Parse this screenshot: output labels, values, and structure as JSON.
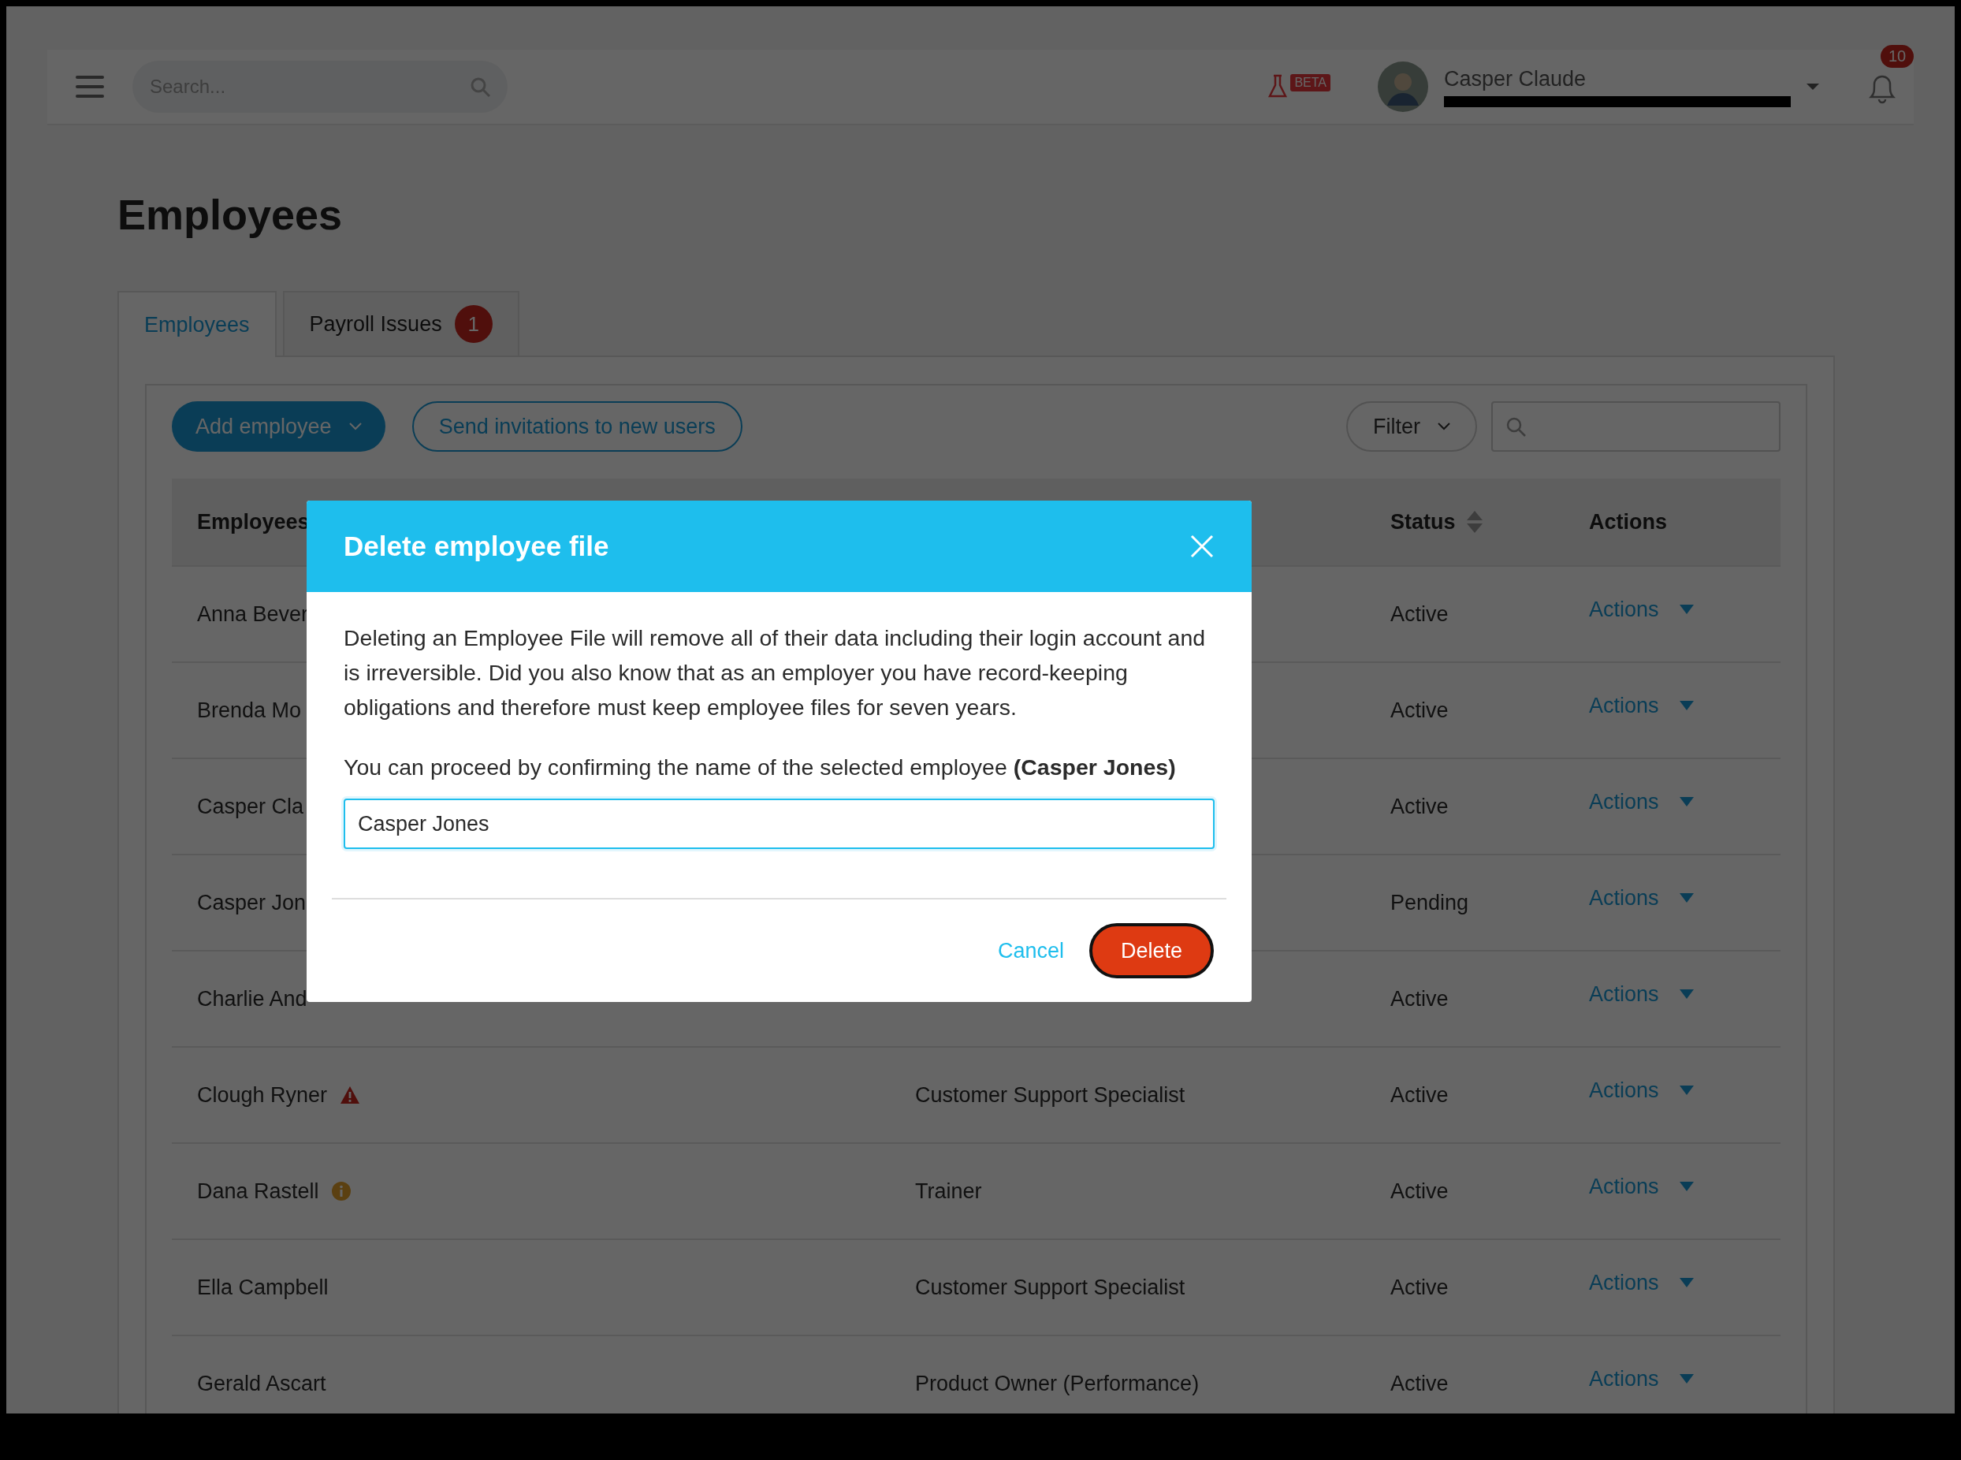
{
  "topbar": {
    "search": {
      "placeholder": "Search..."
    },
    "beta_badge": "BETA",
    "user": {
      "name": "Casper Claude"
    },
    "notifications": {
      "count": "10"
    }
  },
  "page_title": "Employees",
  "tabs": [
    {
      "label": "Employees",
      "selected": true
    },
    {
      "label": "Payroll Issues",
      "selected": false,
      "badge": "1"
    }
  ],
  "toolbar": {
    "add_button": "Add employee",
    "invite_button": "Send invitations to new users",
    "filter_button": "Filter"
  },
  "table": {
    "columns": [
      {
        "label": "Employees",
        "sortable": false
      },
      {
        "label": "Status",
        "sortable": true
      },
      {
        "label": "Actions",
        "sortable": false
      }
    ],
    "rows": [
      {
        "kind": "plain",
        "name": "Anna Bever",
        "status": "Active",
        "action": "Actions"
      },
      {
        "kind": "plain",
        "name": "Brenda Mo",
        "status": "Active",
        "action": "Actions"
      },
      {
        "kind": "plain",
        "name": "Casper Cla",
        "status": "Active",
        "action": "Actions"
      },
      {
        "kind": "plain",
        "name": "Casper Jon",
        "status": "Pending",
        "action": "Actions"
      },
      {
        "kind": "plain",
        "name": "Charlie And",
        "status": "Active",
        "action": "Actions"
      },
      {
        "kind": "warning",
        "name": "Clough Ryner",
        "title": "Customer Support Specialist",
        "status": "Active",
        "action": "Actions"
      },
      {
        "kind": "info",
        "name": "Dana Rastell",
        "title": "Trainer",
        "status": "Active",
        "action": "Actions"
      },
      {
        "kind": "plain",
        "name": "Ella Campbell",
        "title": "Customer Support Specialist",
        "status": "Active",
        "action": "Actions"
      },
      {
        "kind": "plain",
        "name": "Gerald Ascart",
        "title": "Product Owner (Performance)",
        "status": "Active",
        "action": "Actions"
      }
    ]
  },
  "dialog": {
    "title": "Delete employee file",
    "message": "Deleting an Employee File will remove all of their data including their login account and is irreversible. Did you also know that as an employer you have record-keeping obligations and therefore must keep employee files for seven years.",
    "prompt": "You can proceed by confirming the name of the selected employee **(Casper Jones)**",
    "value": "Casper Jones",
    "cancel": "Cancel",
    "confirm": "Delete"
  }
}
